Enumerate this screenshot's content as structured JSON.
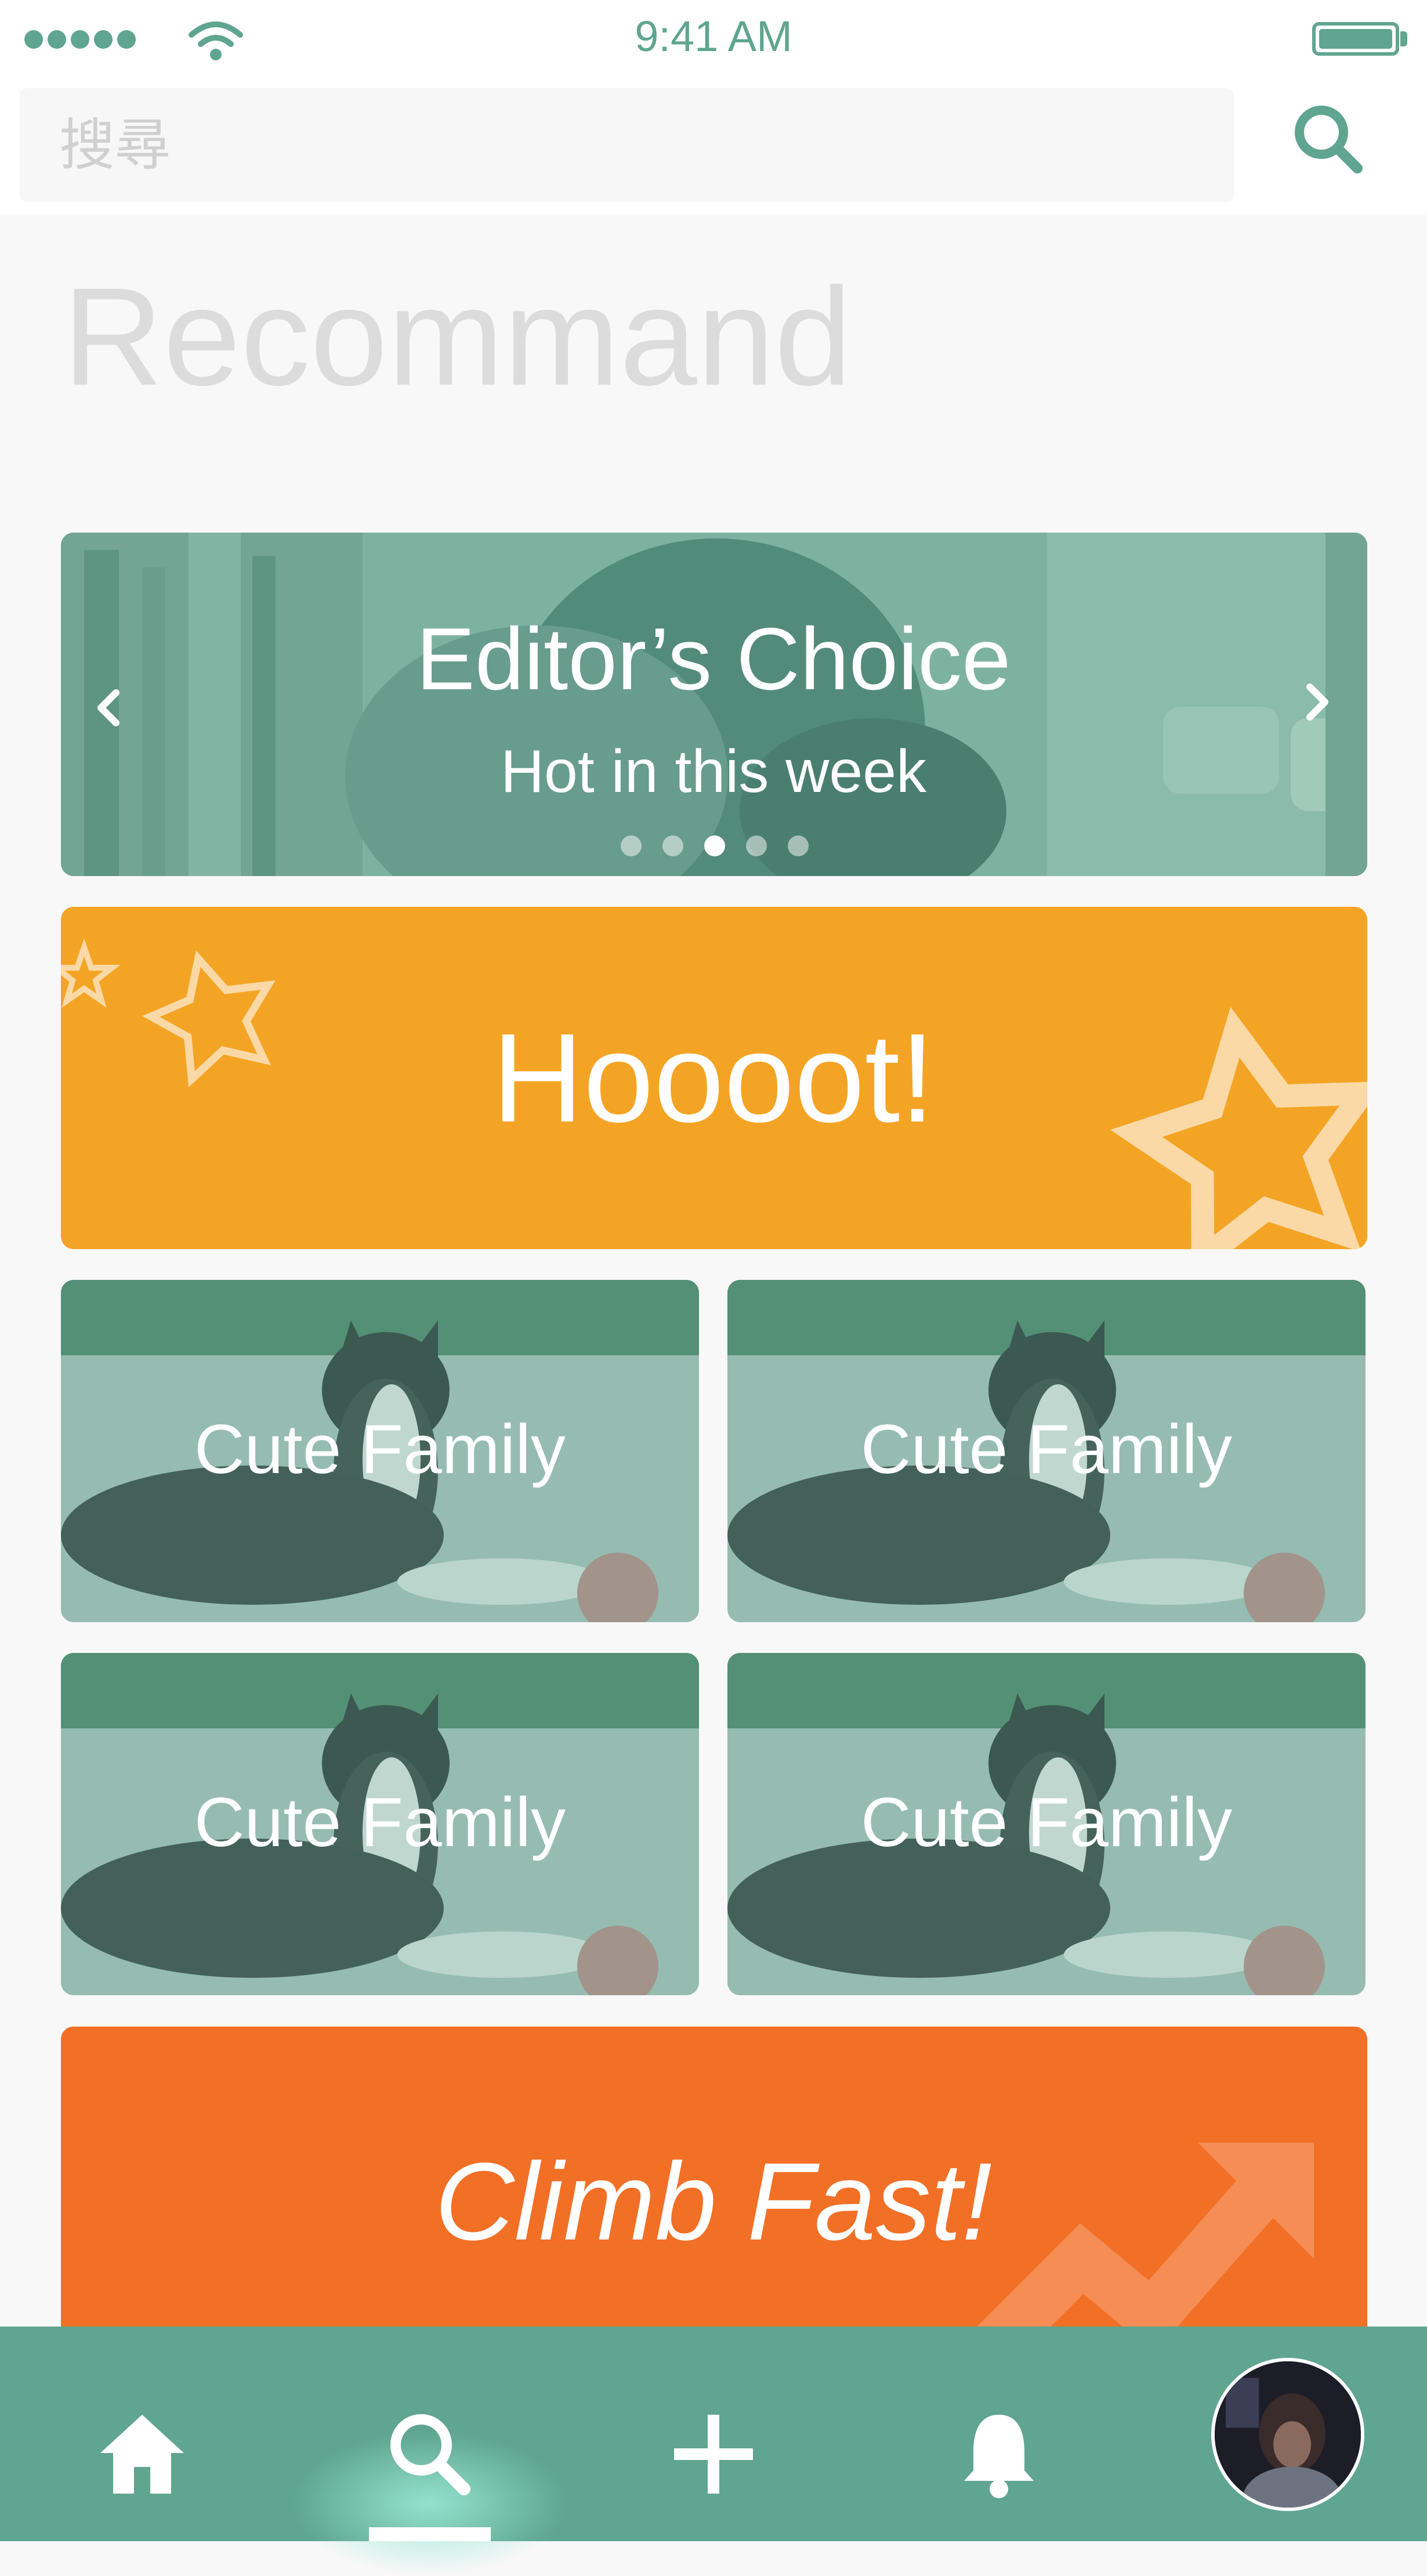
{
  "status_bar": {
    "time": "9:41 AM"
  },
  "search": {
    "placeholder": "搜尋"
  },
  "page_title": "Recommand",
  "carousel": {
    "title": "Editor’s Choice",
    "subtitle": "Hot in this week",
    "page_count": 5,
    "active_page": 3
  },
  "hot_banner": {
    "label": "Hoooot!"
  },
  "cards": [
    {
      "label": "Cute Family"
    },
    {
      "label": "Cute Family"
    },
    {
      "label": "Cute Family"
    },
    {
      "label": "Cute Family"
    }
  ],
  "climb_banner": {
    "label": "Climb Fast!"
  },
  "nav": {
    "items": [
      "home-icon",
      "search-icon",
      "plus-icon",
      "bell-icon",
      "avatar"
    ],
    "active": "search-icon"
  },
  "colors": {
    "accent": "#5fa58f",
    "hot": "#f4a425",
    "climb": "#f26f26",
    "background": "#f8f8f8"
  }
}
